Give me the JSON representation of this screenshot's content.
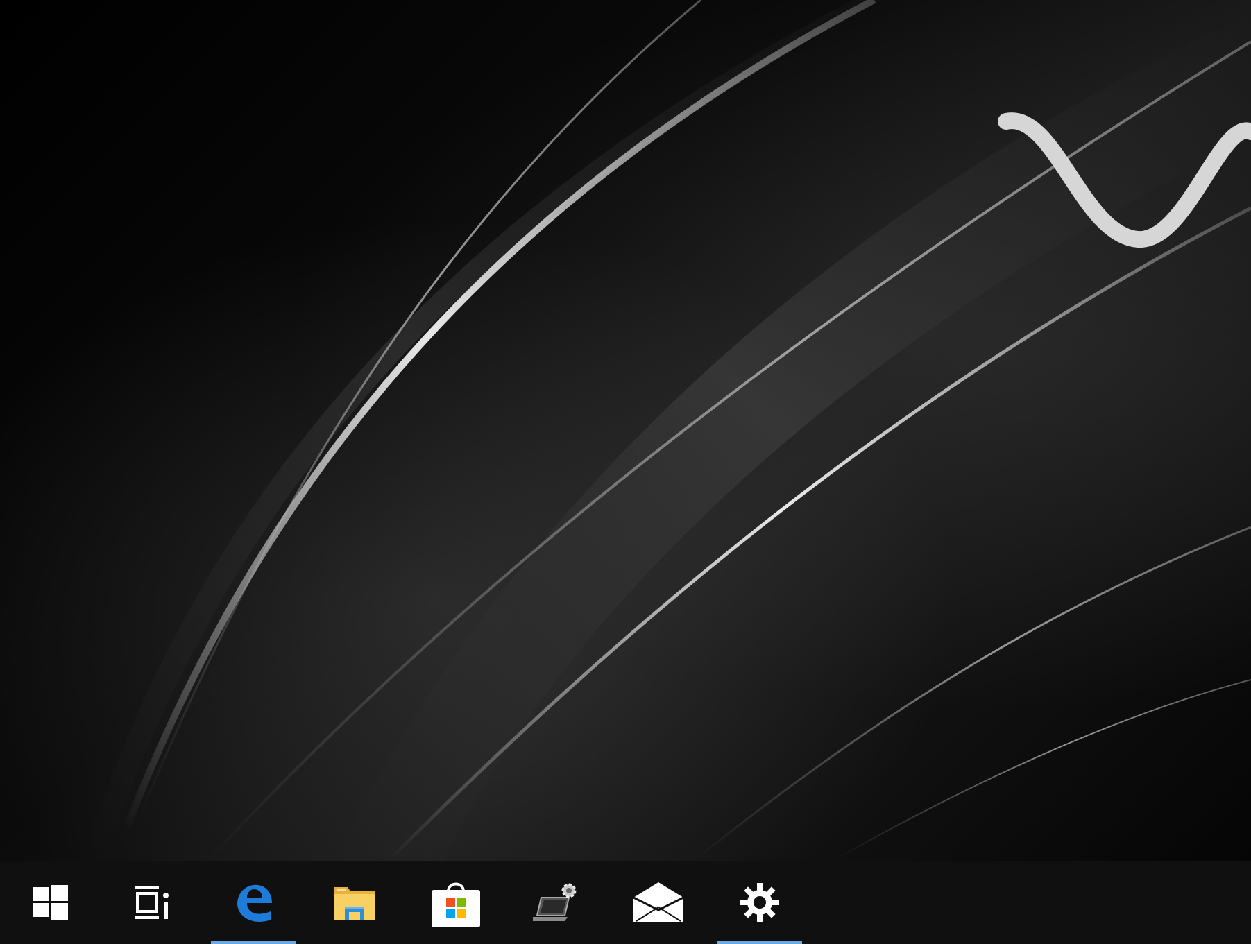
{
  "desktop": {
    "wallpaper": "abstract-black-silver-curves-with-logo"
  },
  "taskbar": {
    "background": "#101010",
    "running_indicator_color": "#6aa8e6",
    "items": [
      {
        "id": "start",
        "icon": "windows-logo-icon",
        "running": false
      },
      {
        "id": "task-view",
        "icon": "task-view-icon",
        "running": false
      },
      {
        "id": "edge",
        "icon": "edge-browser-icon",
        "running": true,
        "color": "#1e7bd8"
      },
      {
        "id": "file-explorer",
        "icon": "folder-icon",
        "running": false,
        "color": "#f3c74a"
      },
      {
        "id": "store",
        "icon": "store-bag-icon",
        "running": false
      },
      {
        "id": "system-settings-legacy",
        "icon": "laptop-gear-icon",
        "running": false
      },
      {
        "id": "mail",
        "icon": "mail-envelope-icon",
        "running": false
      },
      {
        "id": "settings",
        "icon": "gear-icon",
        "running": true
      }
    ]
  }
}
